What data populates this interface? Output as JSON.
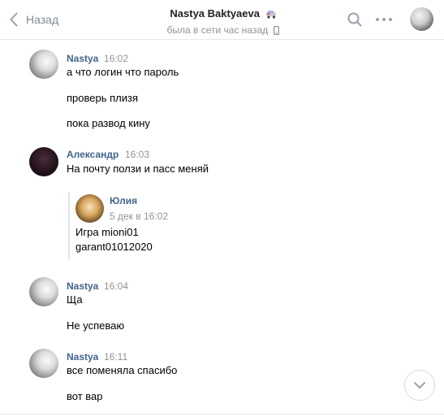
{
  "header": {
    "back_label": "Назад",
    "title": "Nastya Baktyaeva",
    "status": "была в сети час назад"
  },
  "messages": [
    {
      "author": "Nastya",
      "time": "16:02",
      "lines": [
        "а что логин что пароль",
        "проверь плизя",
        "пока развод кину"
      ]
    },
    {
      "author": "Александр",
      "time": "16:03",
      "lines": [
        "На почту ползи и пасс меняй"
      ],
      "forwarded": {
        "author": "Юлия",
        "date": "5 дек в 16:02",
        "lines": [
          "Игра mioni01",
          "garant01012020"
        ]
      }
    },
    {
      "author": "Nastya",
      "time": "16:04",
      "lines": [
        "Ща",
        "Не успеваю"
      ]
    },
    {
      "author": "Nastya",
      "time": "16:11",
      "lines": [
        "все поменяла спасибо",
        "вот вар"
      ]
    }
  ],
  "colors": {
    "author_name": "#42648b",
    "meta_text": "#939393",
    "divider": "#e7e8ec"
  }
}
